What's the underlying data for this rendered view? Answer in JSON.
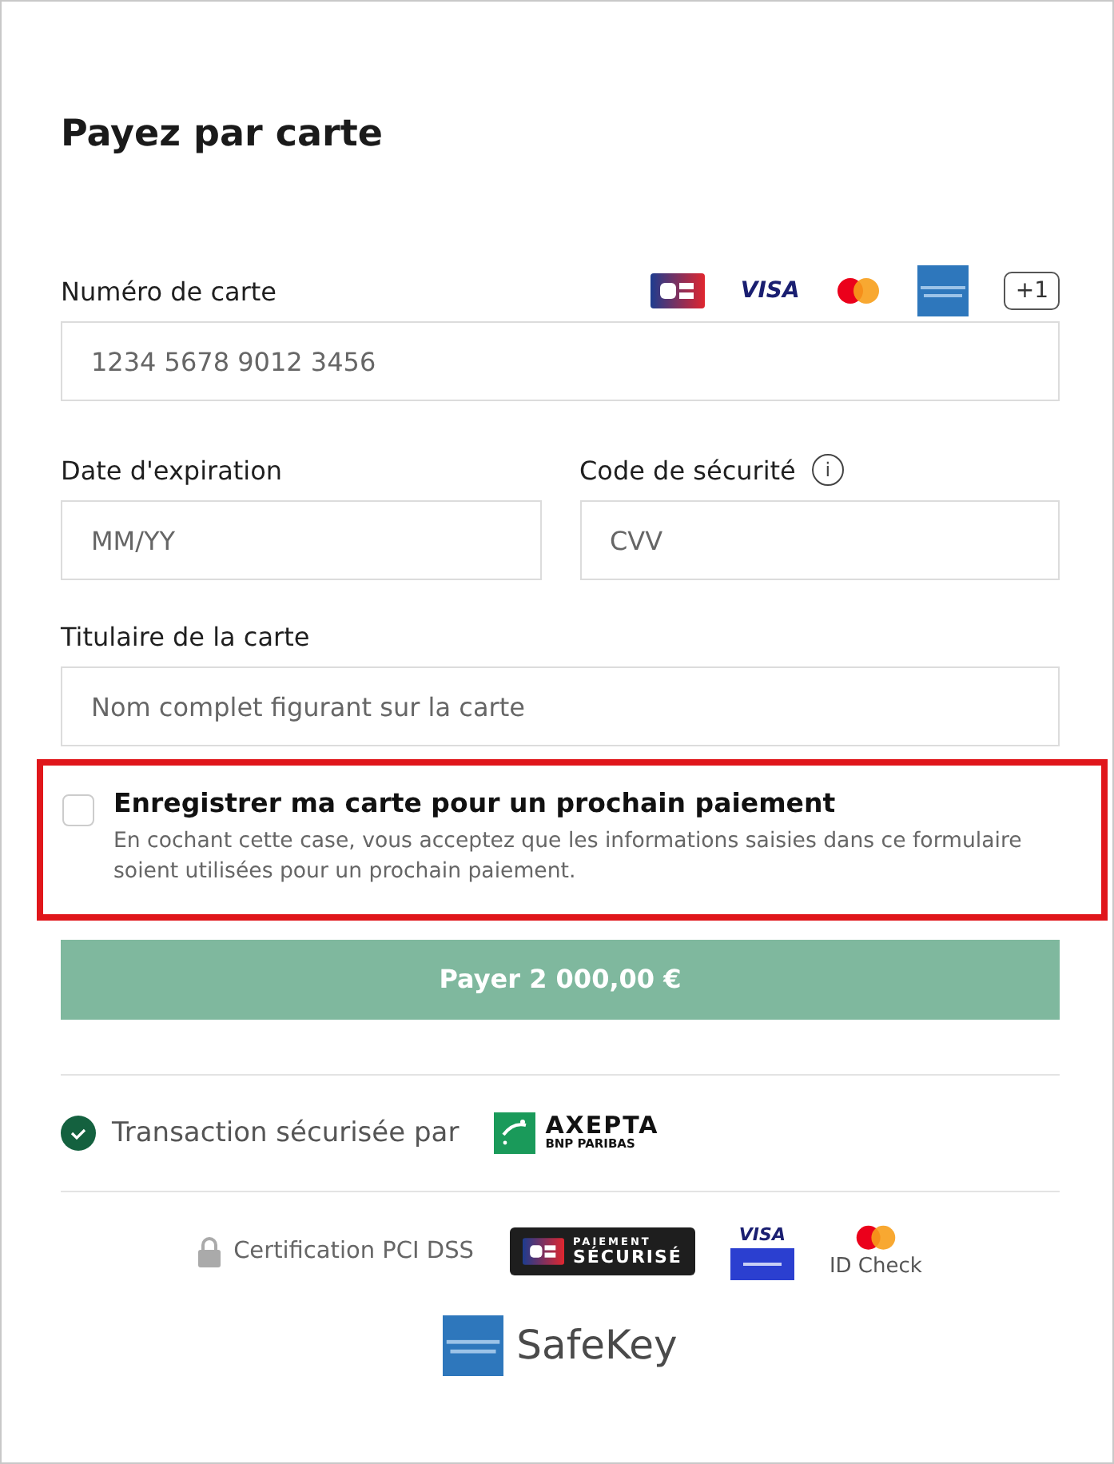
{
  "title": "Payez par carte",
  "card_number": {
    "label": "Numéro de carte",
    "placeholder": "1234 5678 9012 3456",
    "brands": [
      {
        "kind": "cb"
      },
      {
        "kind": "visa",
        "text": "VISA"
      },
      {
        "kind": "mastercard"
      },
      {
        "kind": "amex"
      }
    ],
    "more": "+1"
  },
  "expiry": {
    "label": "Date d'expiration",
    "placeholder": "MM/YY"
  },
  "security_code": {
    "label": "Code de sécurité",
    "info": "i",
    "placeholder": "CVV"
  },
  "holder": {
    "label": "Titulaire de la carte",
    "placeholder": "Nom complet figurant sur la carte"
  },
  "save_card": {
    "checked": false,
    "highlighted": true,
    "label": "Enregistrer ma carte pour un prochain paiement",
    "description": "En cochant cette case, vous acceptez que les informations saisies dans ce formulaire soient utilisées pour un prochain paiement."
  },
  "pay_button": {
    "label": "Payer 2 000,00 €",
    "disabled": true
  },
  "secured_by": {
    "text": "Transaction sécurisée par",
    "brand": "AXEPTA",
    "sub_brand": "BNP PARIBAS"
  },
  "certifications": {
    "pci": "Certification PCI DSS",
    "cb_top": "PAIEMENT",
    "cb_bottom": "SÉCURISÉ",
    "visa": "VISA",
    "mastercard": "ID Check",
    "amex": "SafeKey"
  }
}
